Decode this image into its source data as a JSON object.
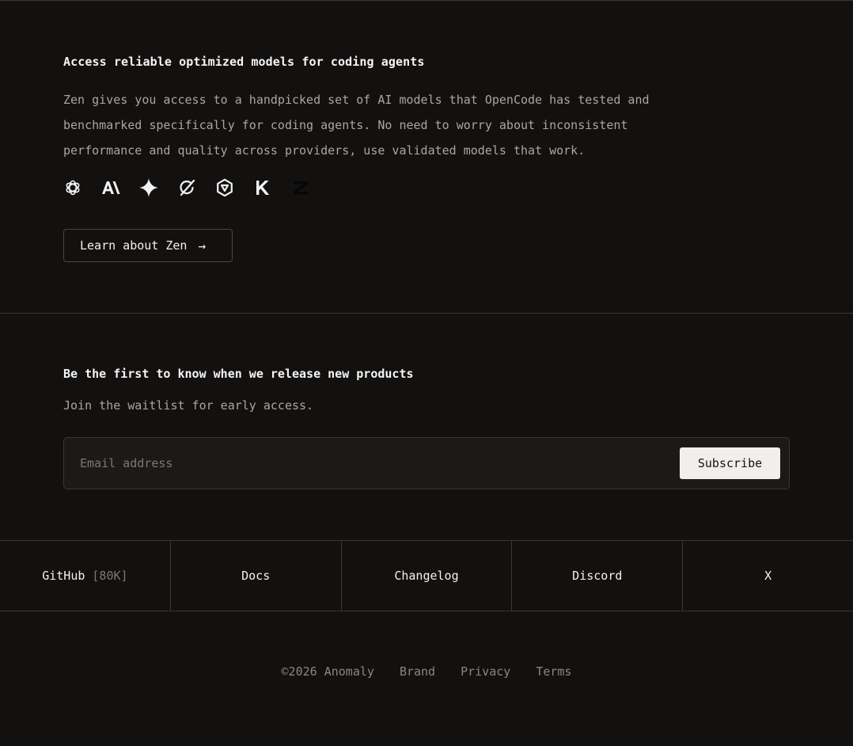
{
  "zen": {
    "heading": "Access reliable optimized models for coding agents",
    "description": "Zen gives you access to a handpicked set of AI models that OpenCode has tested and benchmarked specifically for coding agents. No need to worry about inconsistent performance and quality across providers, use validated models that work.",
    "providers": [
      "openai-icon",
      "anthropic-icon",
      "gemini-icon",
      "grok-icon",
      "qwen-icon",
      "kimi-icon",
      "zai-icon"
    ],
    "button_label": "Learn about Zen",
    "button_arrow": "→"
  },
  "waitlist": {
    "heading": "Be the first to know when we release new products",
    "subtext": "Join the waitlist for early access.",
    "email_placeholder": "Email address",
    "subscribe_label": "Subscribe"
  },
  "links": {
    "github": "GitHub",
    "github_count": "[80K]",
    "docs": "Docs",
    "changelog": "Changelog",
    "discord": "Discord",
    "x": "X"
  },
  "legal": {
    "copyright": "©2026 Anomaly",
    "brand": "Brand",
    "privacy": "Privacy",
    "terms": "Terms"
  }
}
